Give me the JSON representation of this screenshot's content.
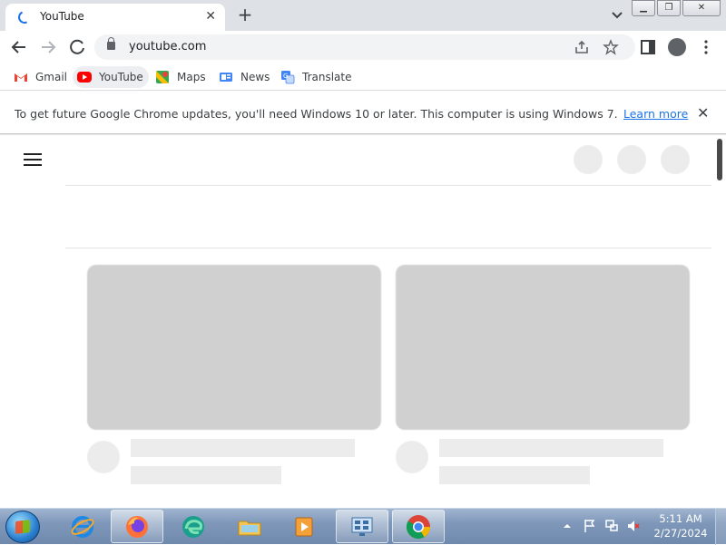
{
  "browser": {
    "tab": {
      "title": "YouTube",
      "close": "✕"
    },
    "new_tab": "+",
    "window_controls": {
      "minimize": "▁",
      "restore": "❐",
      "close": "✕"
    },
    "url": "youtube.com",
    "bookmarks": [
      {
        "label": "Gmail",
        "icon": "gmail-icon"
      },
      {
        "label": "YouTube",
        "icon": "youtube-icon"
      },
      {
        "label": "Maps",
        "icon": "maps-icon"
      },
      {
        "label": "News",
        "icon": "news-icon"
      },
      {
        "label": "Translate",
        "icon": "translate-icon"
      }
    ]
  },
  "infobar": {
    "message": "To get future Google Chrome updates, you'll need Windows 10 or later. This computer is using Windows 7.",
    "learn_more": "Learn more",
    "close": "✕"
  },
  "taskbar": {
    "clock_time": "5:11 AM",
    "clock_date": "2/27/2024",
    "apps": [
      "internet-explorer",
      "firefox",
      "edge",
      "file-explorer",
      "media-player",
      "control-panel",
      "chrome"
    ]
  },
  "colors": {
    "accent": "#1a73e8",
    "youtube_red": "#ff0000",
    "skeleton": "#d0d0d0",
    "skeleton_light": "#ececec"
  }
}
